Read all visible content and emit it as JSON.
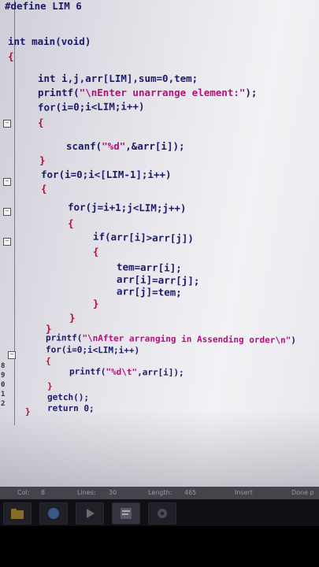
{
  "editor": {
    "lines": [
      {
        "parts": [
          {
            "t": "#define LIM 6",
            "c": "kw"
          }
        ]
      },
      {
        "parts": [
          {
            "t": "int main(void)",
            "c": "kw"
          }
        ]
      },
      {
        "parts": [
          {
            "t": "{",
            "c": "brace"
          }
        ]
      },
      {
        "parts": [
          {
            "t": "int i,j,arr[LIM],sum=0,tem;",
            "c": "kw"
          }
        ]
      },
      {
        "parts": [
          {
            "t": "printf(",
            "c": "kw"
          },
          {
            "t": "\"\\nEnter unarrange element:\"",
            "c": "str"
          },
          {
            "t": ");",
            "c": "kw"
          }
        ]
      },
      {
        "parts": [
          {
            "t": "for(i=0;i<LIM;i++)",
            "c": "kw"
          }
        ]
      },
      {
        "parts": [
          {
            "t": "{",
            "c": "brace"
          }
        ]
      },
      {
        "parts": [
          {
            "t": "scanf(",
            "c": "kw"
          },
          {
            "t": "\"%d\"",
            "c": "str"
          },
          {
            "t": ",&arr[i]);",
            "c": "kw"
          }
        ]
      },
      {
        "parts": [
          {
            "t": "}",
            "c": "brace"
          }
        ]
      },
      {
        "parts": [
          {
            "t": "for(i=0;i<[LIM-1];i++)",
            "c": "kw"
          }
        ]
      },
      {
        "parts": [
          {
            "t": "{",
            "c": "brace"
          }
        ]
      },
      {
        "parts": [
          {
            "t": "for(j=i+1;j<LIM;j++)",
            "c": "kw"
          }
        ]
      },
      {
        "parts": [
          {
            "t": "{",
            "c": "brace"
          }
        ]
      },
      {
        "parts": [
          {
            "t": "if(arr[i]>arr[j])",
            "c": "kw"
          }
        ]
      },
      {
        "parts": [
          {
            "t": "{",
            "c": "brace"
          }
        ]
      },
      {
        "parts": [
          {
            "t": "tem=arr[i];",
            "c": "kw"
          }
        ]
      },
      {
        "parts": [
          {
            "t": "arr[i]=arr[j];",
            "c": "kw"
          }
        ]
      },
      {
        "parts": [
          {
            "t": "arr[j]=tem;",
            "c": "kw"
          }
        ]
      },
      {
        "parts": [
          {
            "t": "}",
            "c": "brace"
          }
        ]
      },
      {
        "parts": [
          {
            "t": "}",
            "c": "brace"
          }
        ]
      },
      {
        "parts": [
          {
            "t": "}",
            "c": "brace"
          }
        ]
      },
      {
        "parts": [
          {
            "t": "printf(",
            "c": "kw"
          },
          {
            "t": "\"\\nAfter arranging in Assending order\\n\"",
            "c": "str"
          },
          {
            "t": ")",
            "c": "kw"
          }
        ]
      },
      {
        "parts": [
          {
            "t": "for(i=0;i<LIM;i++)",
            "c": "kw"
          }
        ]
      },
      {
        "parts": [
          {
            "t": "{",
            "c": "brace"
          }
        ]
      },
      {
        "parts": [
          {
            "t": "printf(",
            "c": "kw"
          },
          {
            "t": "\"%d\\t\"",
            "c": "str"
          },
          {
            "t": ",arr[i]);",
            "c": "kw"
          }
        ]
      },
      {
        "parts": [
          {
            "t": "}",
            "c": "brace"
          }
        ]
      },
      {
        "parts": [
          {
            "t": "getch();",
            "c": "kw"
          }
        ]
      },
      {
        "parts": [
          {
            "t": "return 0;",
            "c": "kw"
          }
        ]
      },
      {
        "parts": [
          {
            "t": "}",
            "c": "brace"
          }
        ]
      }
    ],
    "line_numbers": [
      "8",
      "9",
      "0",
      "1",
      "2"
    ]
  },
  "statusbar": {
    "col_label": "Col:",
    "col_value": "8",
    "lines_label": "Lines:",
    "lines_value": "30",
    "length_label": "Length:",
    "length_value": "465",
    "mode": "Insert",
    "state": "Done p"
  },
  "colors": {
    "keyword": "#1a1a6a",
    "string": "#b0127a",
    "brace": "#d0002a"
  }
}
